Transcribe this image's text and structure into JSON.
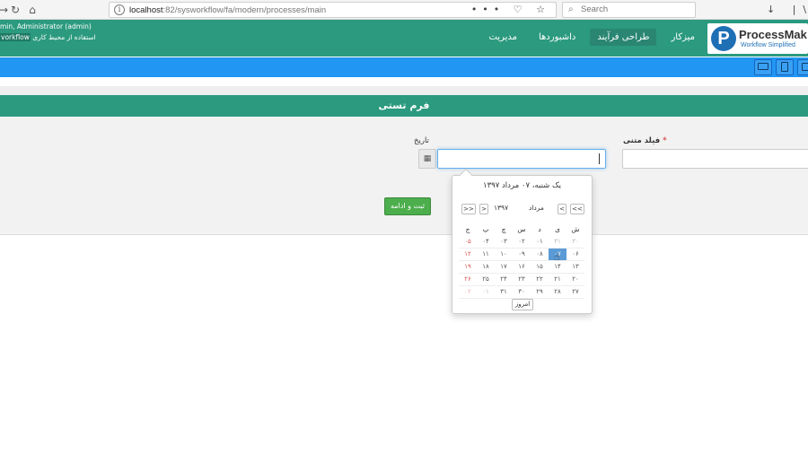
{
  "browser": {
    "url_host": "localhost",
    "url_rest": ":82/sysworkflow/fa/modern/processes/main",
    "search_placeholder": "Search",
    "url_actions": "••• ♡ ☆",
    "right_icons": "↓ |\\ ▯"
  },
  "header": {
    "user_line1": "min, Administrator (admin)",
    "user_line2_prefix": "استفاده از محیط کاری",
    "user_line2_link": "vorkflow",
    "menu": [
      {
        "label": "میزکار"
      },
      {
        "label": "طراحی فرآیند"
      },
      {
        "label": "داشبوردها"
      },
      {
        "label": "مدیریت"
      }
    ],
    "logo_letter": "P",
    "logo_name": "ProcessMak",
    "logo_tagline": "Workflow Simplified"
  },
  "form": {
    "title": "فرم تستی",
    "text_field_label": "فیلد متنی",
    "required_mark": "*",
    "date_field_label": "تاریخ",
    "submit_label": "ثبت و ادامه"
  },
  "datepicker": {
    "header": "یک شنبه، ۰۷ مرداد ۱۳۹۷",
    "prev_month": "<",
    "prev_year": "<<",
    "next_month": ">",
    "next_year": ">>",
    "month": "مرداد",
    "year": "۱۳۹۷",
    "today_label": "امروز",
    "weekdays": [
      "ج",
      "پ",
      "چ",
      "س",
      "د",
      "ی",
      "ش"
    ],
    "weeks": [
      [
        "۰۵",
        "۰۴",
        "۰۳",
        "۰۲",
        "۰۱",
        "۳۱",
        "۳۰"
      ],
      [
        "۱۲",
        "۱۱",
        "۱۰",
        "۰۹",
        "۰۸",
        "۰۷",
        "۰۶"
      ],
      [
        "۱۹",
        "۱۸",
        "۱۷",
        "۱۶",
        "۱۵",
        "۱۴",
        "۱۳"
      ],
      [
        "۲۶",
        "۲۵",
        "۲۴",
        "۲۳",
        "۲۲",
        "۲۱",
        "۲۰"
      ],
      [
        "۰۲",
        "۰۱",
        "۳۱",
        "۳۰",
        "۲۹",
        "۲۸",
        "۲۷"
      ]
    ],
    "selected": "۰۷",
    "colors": {
      "accent": "#2b9a7f",
      "toolbar": "#2196f3",
      "selected": "#5b9bd5",
      "submit": "#4cae4c"
    }
  }
}
